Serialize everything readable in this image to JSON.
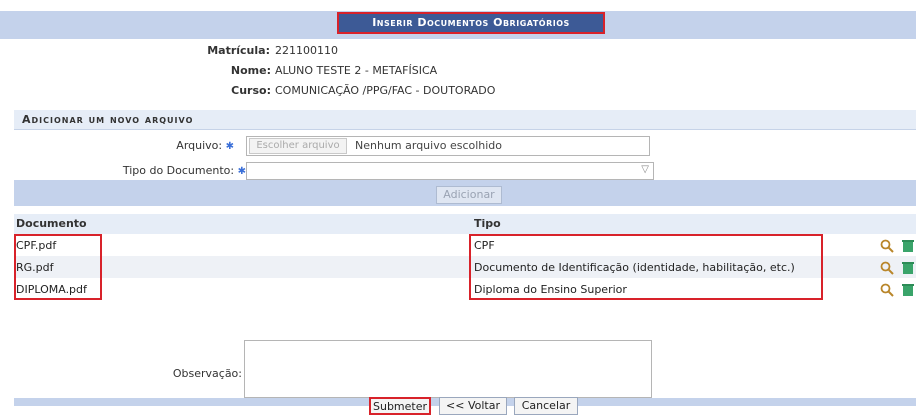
{
  "title": "Inserir Documentos Obrigatórios",
  "student": {
    "matricula_label": "Matrícula:",
    "matricula": "221100110",
    "nome_label": "Nome:",
    "nome": "ALUNO TESTE 2 - METAFÍSICA",
    "curso_label": "Curso:",
    "curso": "COMUNICAÇÃO /PPG/FAC - DOUTORADO"
  },
  "upload": {
    "section_title": "Adicionar um novo arquivo",
    "arquivo_label": "Arquivo:",
    "choose_button": "Escolher arquivo",
    "no_file": "Nenhum arquivo escolhido",
    "tipo_label": "Tipo do Documento:",
    "tipo_value": "",
    "add_button": "Adicionar"
  },
  "documents": {
    "col_documento": "Documento",
    "col_tipo": "Tipo",
    "rows": [
      {
        "file": "CPF.pdf",
        "tipo": "CPF"
      },
      {
        "file": "RG.pdf",
        "tipo": "Documento de Identificação (identidade, habilitação, etc.)"
      },
      {
        "file": "DIPLOMA.pdf",
        "tipo": "Diploma do Ensino Superior"
      }
    ]
  },
  "observacao_label": "Observação:",
  "observacao_value": "",
  "buttons": {
    "submit": "Submeter",
    "back": "<< Voltar",
    "cancel": "Cancelar"
  },
  "colors": {
    "header_bg": "#3d5a96",
    "bar_bg": "#c4d2eb",
    "highlight": "#d8222a",
    "required": "#3a6fd8"
  }
}
